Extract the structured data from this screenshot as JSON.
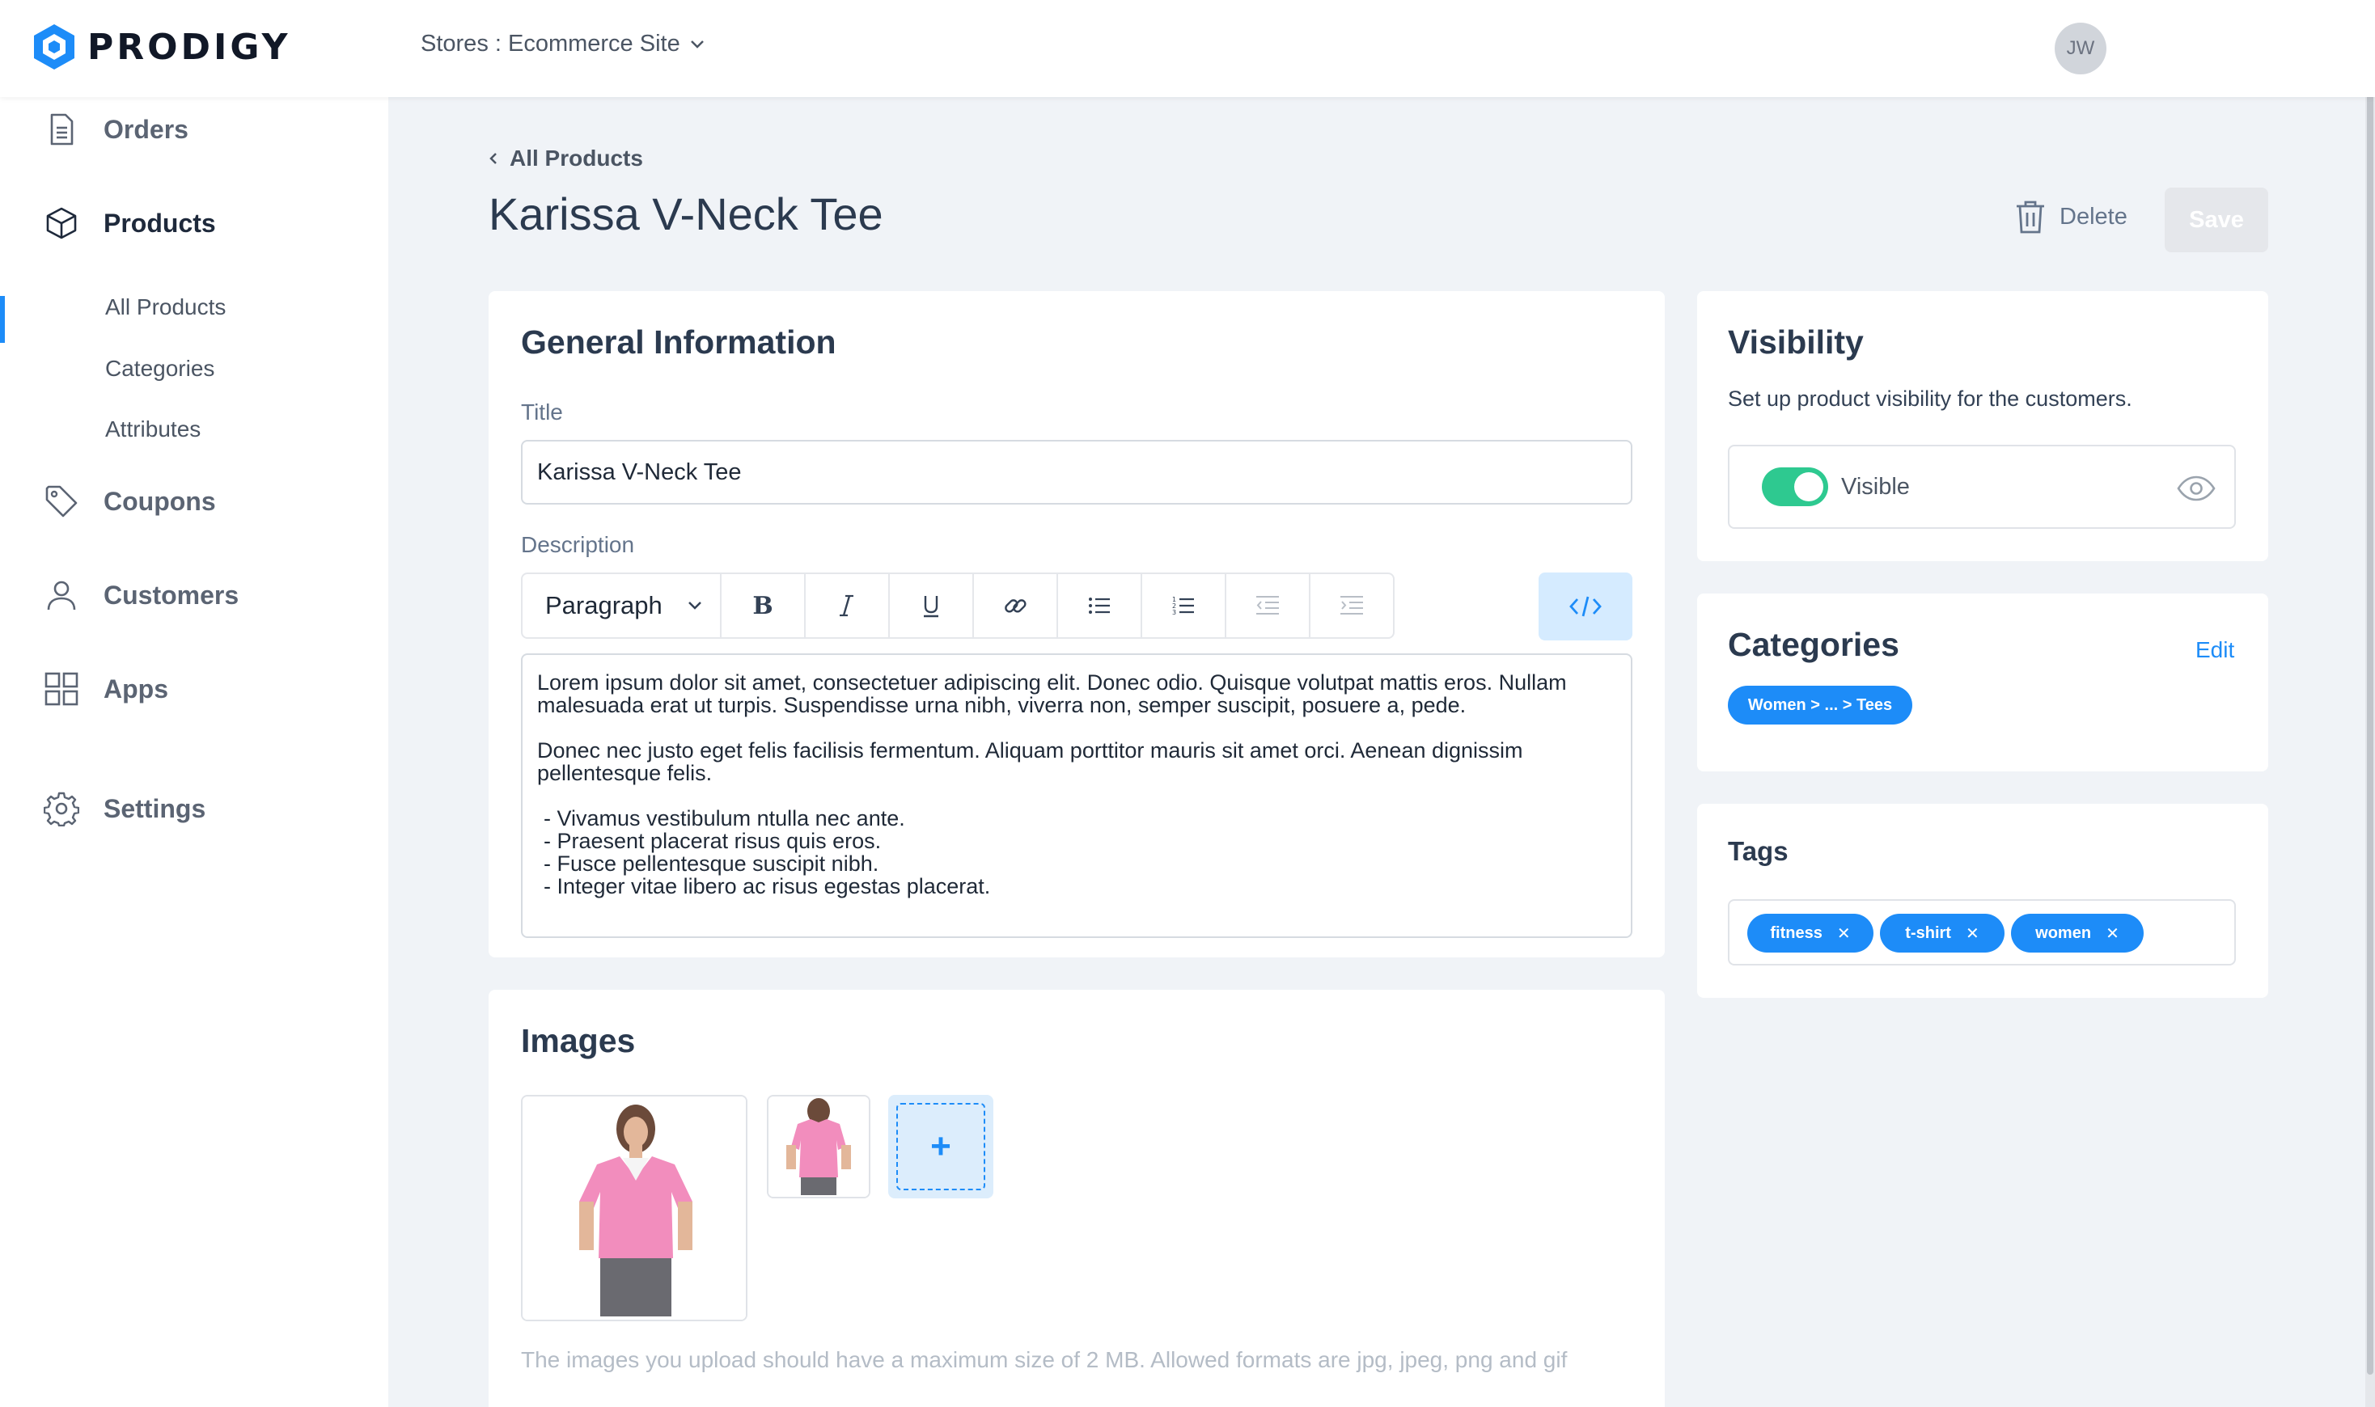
{
  "brand": {
    "name": "PRODIGY",
    "accent": "#1d8cf8",
    "success": "#2ec990"
  },
  "header": {
    "store_selector": "Stores : Ecommerce Site",
    "avatar_initials": "JW"
  },
  "sidebar": {
    "items": [
      {
        "label": "Orders",
        "icon": "document-icon"
      },
      {
        "label": "Products",
        "icon": "box-icon"
      },
      {
        "label": "Coupons",
        "icon": "tag-icon"
      },
      {
        "label": "Customers",
        "icon": "user-icon"
      },
      {
        "label": "Apps",
        "icon": "grid-icon"
      },
      {
        "label": "Settings",
        "icon": "gear-icon"
      }
    ],
    "products_sub": [
      "All Products",
      "Categories",
      "Attributes"
    ]
  },
  "page": {
    "back_label": "All Products",
    "title": "Karissa V-Neck Tee",
    "delete_label": "Delete",
    "save_label": "Save"
  },
  "general": {
    "heading": "General Information",
    "title_label": "Title",
    "title_value": "Karissa V-Neck Tee",
    "description_label": "Description",
    "block_format": "Paragraph",
    "description": {
      "p1": "Lorem ipsum dolor sit amet, consectetuer adipiscing elit. Donec odio. Quisque volutpat mattis eros. Nullam malesuada erat ut turpis. Suspendisse urna nibh, viverra non, semper suscipit, posuere a, pede.",
      "p2": "Donec nec justo eget felis facilisis fermentum. Aliquam porttitor mauris sit amet orci. Aenean dignissim pellentesque felis.",
      "list": [
        "- Vivamus vestibulum ntulla nec ante.",
        "- Praesent placerat risus quis eros.",
        "- Fusce pellentesque suscipit nibh.",
        "- Integer vitae libero ac risus egestas placerat."
      ]
    }
  },
  "images": {
    "heading": "Images",
    "add_symbol": "+",
    "helper": "The images you upload should have a maximum size of 2 MB. Allowed formats are jpg, jpeg, png and gif"
  },
  "visibility": {
    "heading": "Visibility",
    "description": "Set up product visibility for the customers.",
    "toggle_label": "Visible",
    "enabled": true
  },
  "categories": {
    "heading": "Categories",
    "edit_label": "Edit",
    "chips": [
      "Women > ... > Tees"
    ]
  },
  "tags": {
    "heading": "Tags",
    "chips": [
      "fitness",
      "t-shirt",
      "women"
    ],
    "remove_symbol": "✕"
  }
}
